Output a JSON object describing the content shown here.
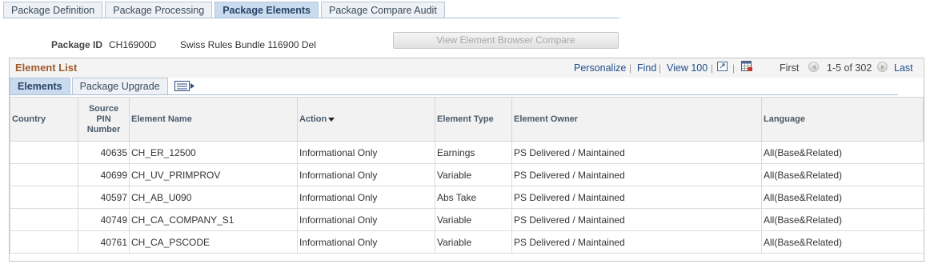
{
  "top_tabs": [
    {
      "label": "Package Definition"
    },
    {
      "label": "Package Processing"
    },
    {
      "label": "Package Elements"
    },
    {
      "label": "Package Compare Audit"
    }
  ],
  "package": {
    "id_label": "Package ID",
    "id_value": "CH16900D",
    "description": "Swiss Rules Bundle 116900 Del",
    "view_button": "View Element Browser Compare"
  },
  "grid": {
    "title": "Element List",
    "personalize": "Personalize",
    "find": "Find",
    "view_all": "View 100",
    "first": "First",
    "range": "1-5 of 302",
    "last": "Last",
    "sep": "|"
  },
  "sub_tabs": [
    {
      "label": "Elements"
    },
    {
      "label": "Package Upgrade"
    }
  ],
  "columns": {
    "country": "Country",
    "pin_1": "Source",
    "pin_2": "PIN",
    "pin_3": "Number",
    "element_name": "Element Name",
    "action": "Action",
    "element_type": "Element Type",
    "element_owner": "Element Owner",
    "language": "Language"
  },
  "rows": [
    {
      "country": "",
      "pin": "40635",
      "name": "CH_ER_12500",
      "action": "Informational Only",
      "type": "Earnings",
      "owner": "PS Delivered / Maintained",
      "language": "All(Base&Related)"
    },
    {
      "country": "",
      "pin": "40699",
      "name": "CH_UV_PRIMPROV",
      "action": "Informational Only",
      "type": "Variable",
      "owner": "PS Delivered / Maintained",
      "language": "All(Base&Related)"
    },
    {
      "country": "",
      "pin": "40597",
      "name": "CH_AB_U090",
      "action": "Informational Only",
      "type": "Abs Take",
      "owner": "PS Delivered / Maintained",
      "language": "All(Base&Related)"
    },
    {
      "country": "",
      "pin": "40749",
      "name": "CH_CA_COMPANY_S1",
      "action": "Informational Only",
      "type": "Variable",
      "owner": "PS Delivered / Maintained",
      "language": "All(Base&Related)"
    },
    {
      "country": "",
      "pin": "40761",
      "name": "CH_CA_PSCODE",
      "action": "Informational Only",
      "type": "Variable",
      "owner": "PS Delivered / Maintained",
      "language": "All(Base&Related)"
    }
  ]
}
